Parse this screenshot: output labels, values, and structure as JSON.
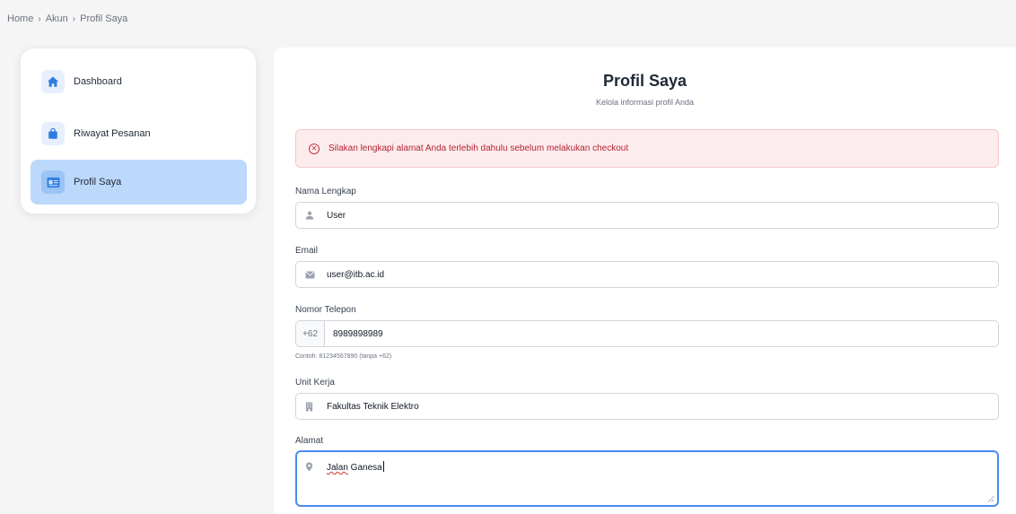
{
  "breadcrumb": {
    "home": "Home",
    "akun": "Akun",
    "current": "Profil Saya",
    "separator": "›"
  },
  "sidebar": {
    "items": [
      {
        "label": "Dashboard",
        "icon": "home-icon"
      },
      {
        "label": "Riwayat Pesanan",
        "icon": "shopping-bag-icon"
      },
      {
        "label": "Profil Saya",
        "icon": "id-card-icon",
        "active": true
      }
    ]
  },
  "main": {
    "title": "Profil Saya",
    "subtitle": "Kelola informasi profil Anda",
    "alert": "Silakan lengkapi alamat Anda terlebih dahulu sebelum melakukan checkout",
    "fields": {
      "nama": {
        "label": "Nama Lengkap",
        "value": "User",
        "icon": "user-icon"
      },
      "email": {
        "label": "Email",
        "value": "user@itb.ac.id",
        "icon": "envelope-icon"
      },
      "telepon": {
        "label": "Nomor Telepon",
        "prefix": "+62",
        "value": "8989898989",
        "helper": "Contoh: 81234567890 (tanpa +62)"
      },
      "unit": {
        "label": "Unit Kerja",
        "value": "Fakultas Teknik Elektro",
        "icon": "building-icon"
      },
      "alamat": {
        "label": "Alamat",
        "value_word1": "Jalan",
        "value_word2": " Ganesa",
        "icon": "map-pin-icon"
      }
    }
  },
  "colors": {
    "accent": "#4a8af2",
    "active_nav": "#bcd8fb",
    "alert_bg": "#fdecee",
    "alert_text": "#b42332"
  }
}
